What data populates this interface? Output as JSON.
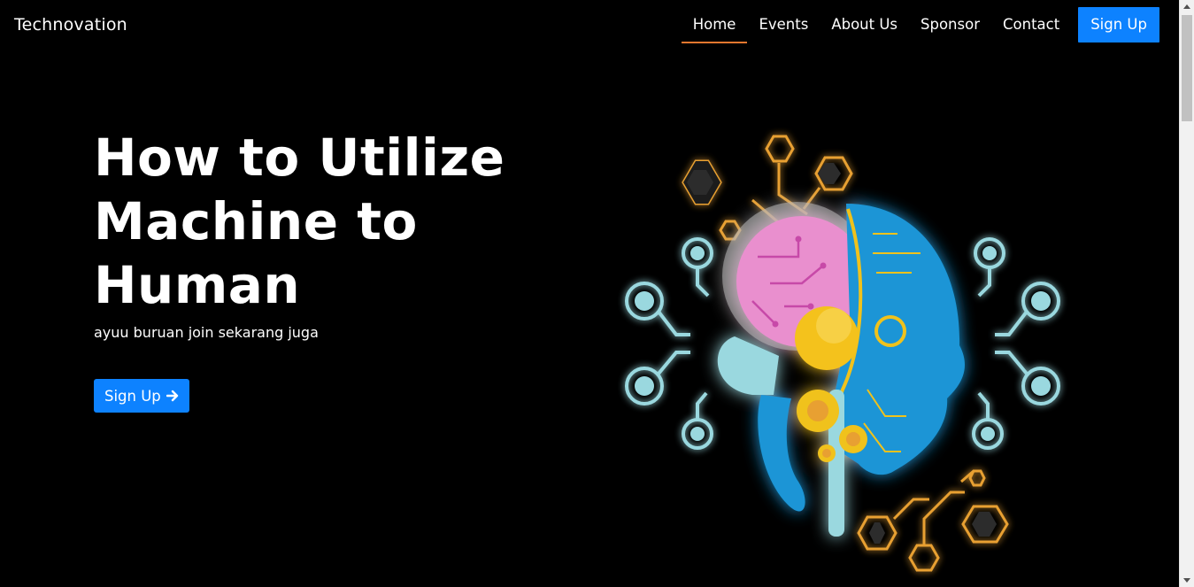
{
  "brand": "Technovation",
  "nav": {
    "items": [
      "Home",
      "Events",
      "About Us",
      "Sponsor",
      "Contact"
    ],
    "active": "Home",
    "signup": "Sign Up"
  },
  "hero": {
    "title": "How to Utilize Machine to Human",
    "subtitle": "ayuu buruan join sekarang juga",
    "button": "Sign Up",
    "button_icon": "arrow-right-icon"
  },
  "illustration": {
    "icon": "ai-head-brain-illustration"
  },
  "colors": {
    "accent": "#0d82ff",
    "active_underline": "#e8772e",
    "background": "#000000"
  }
}
